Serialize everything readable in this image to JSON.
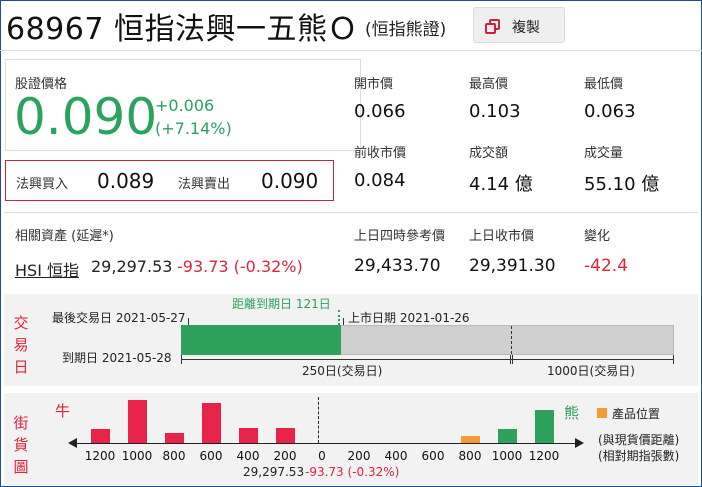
{
  "header": {
    "title": "68967 恒指法興一五熊Ｏ",
    "subtitle": "(恒指熊證)",
    "copy_label": "複製"
  },
  "price": {
    "label": "股證價格",
    "value": "0.090",
    "change": "+0.006",
    "change_pct": "(+7.14%)"
  },
  "bid_ask": {
    "bid_label": "法興買入",
    "bid": "0.089",
    "ask_label": "法興賣出",
    "ask": "0.090"
  },
  "stats": [
    {
      "label": "開市價",
      "value": "0.066"
    },
    {
      "label": "最高價",
      "value": "0.103"
    },
    {
      "label": "最低價",
      "value": "0.063"
    },
    {
      "label": "前收市價",
      "value": "0.084"
    },
    {
      "label": "成交額",
      "value": "4.14 億"
    },
    {
      "label": "成交量",
      "value": "55.10 億"
    }
  ],
  "underlying": {
    "label": "相關資產 (延遲*)",
    "link": "HSI 恒指",
    "price": "29,297.53",
    "change": "-93.73 (-0.32%)",
    "ref_label": "上日四時參考價",
    "ref_value": "29,433.70",
    "close_label": "上日收市價",
    "close_value": "29,391.30",
    "chg_label": "變化",
    "chg_value": "-42.4"
  },
  "timeline": {
    "side_label": [
      "交",
      "易",
      "日"
    ],
    "last_trading": "最後交易日 2021-05-27",
    "remaining": "距離到期日 121日",
    "listing": "上市日期 2021-01-26",
    "expiry": "到期日 2021-05-28",
    "scale_250": "250日(交易日)",
    "scale_1000": "1000日(交易日)",
    "remaining_days": 121,
    "elapsed_fraction": 0.325,
    "colors": {
      "elapsed": "#2ea15a",
      "remaining": "#cfcfcf"
    }
  },
  "distribution": {
    "side_label": [
      "街",
      "貨",
      "圖"
    ],
    "bull_label": "牛",
    "bear_label": "熊",
    "legend_label": "產品位置",
    "note_1": "(與現貨價距離)",
    "note_2": "(相對期指張數)",
    "current": "29,297.53",
    "current_change": "-93.73 (-0.32%)",
    "axis_labels": [
      "1200",
      "1000",
      "800",
      "600",
      "400",
      "200",
      "0",
      "200",
      "400",
      "600",
      "800",
      "1000",
      "1200"
    ]
  },
  "chart_data": {
    "type": "bar",
    "categories": [
      "1200",
      "1000",
      "800",
      "600",
      "400",
      "200",
      "0",
      "200",
      "400",
      "600",
      "800",
      "1000",
      "1200"
    ],
    "series": [
      {
        "name": "牛",
        "values": [
          14,
          43,
          10,
          40,
          15,
          15,
          0,
          0,
          0,
          0,
          0,
          0,
          0
        ],
        "color": "#e6244a"
      },
      {
        "name": "熊",
        "values": [
          0,
          0,
          0,
          0,
          0,
          0,
          0,
          0,
          0,
          0,
          0,
          14,
          33
        ],
        "color": "#2ea15a"
      },
      {
        "name": "產品位置",
        "values": [
          0,
          0,
          0,
          0,
          0,
          0,
          0,
          0,
          0,
          0,
          7,
          0,
          0
        ],
        "color": "#f39c33"
      }
    ],
    "ylim": [
      0,
      45
    ],
    "legend": "top-right",
    "grid": false
  }
}
